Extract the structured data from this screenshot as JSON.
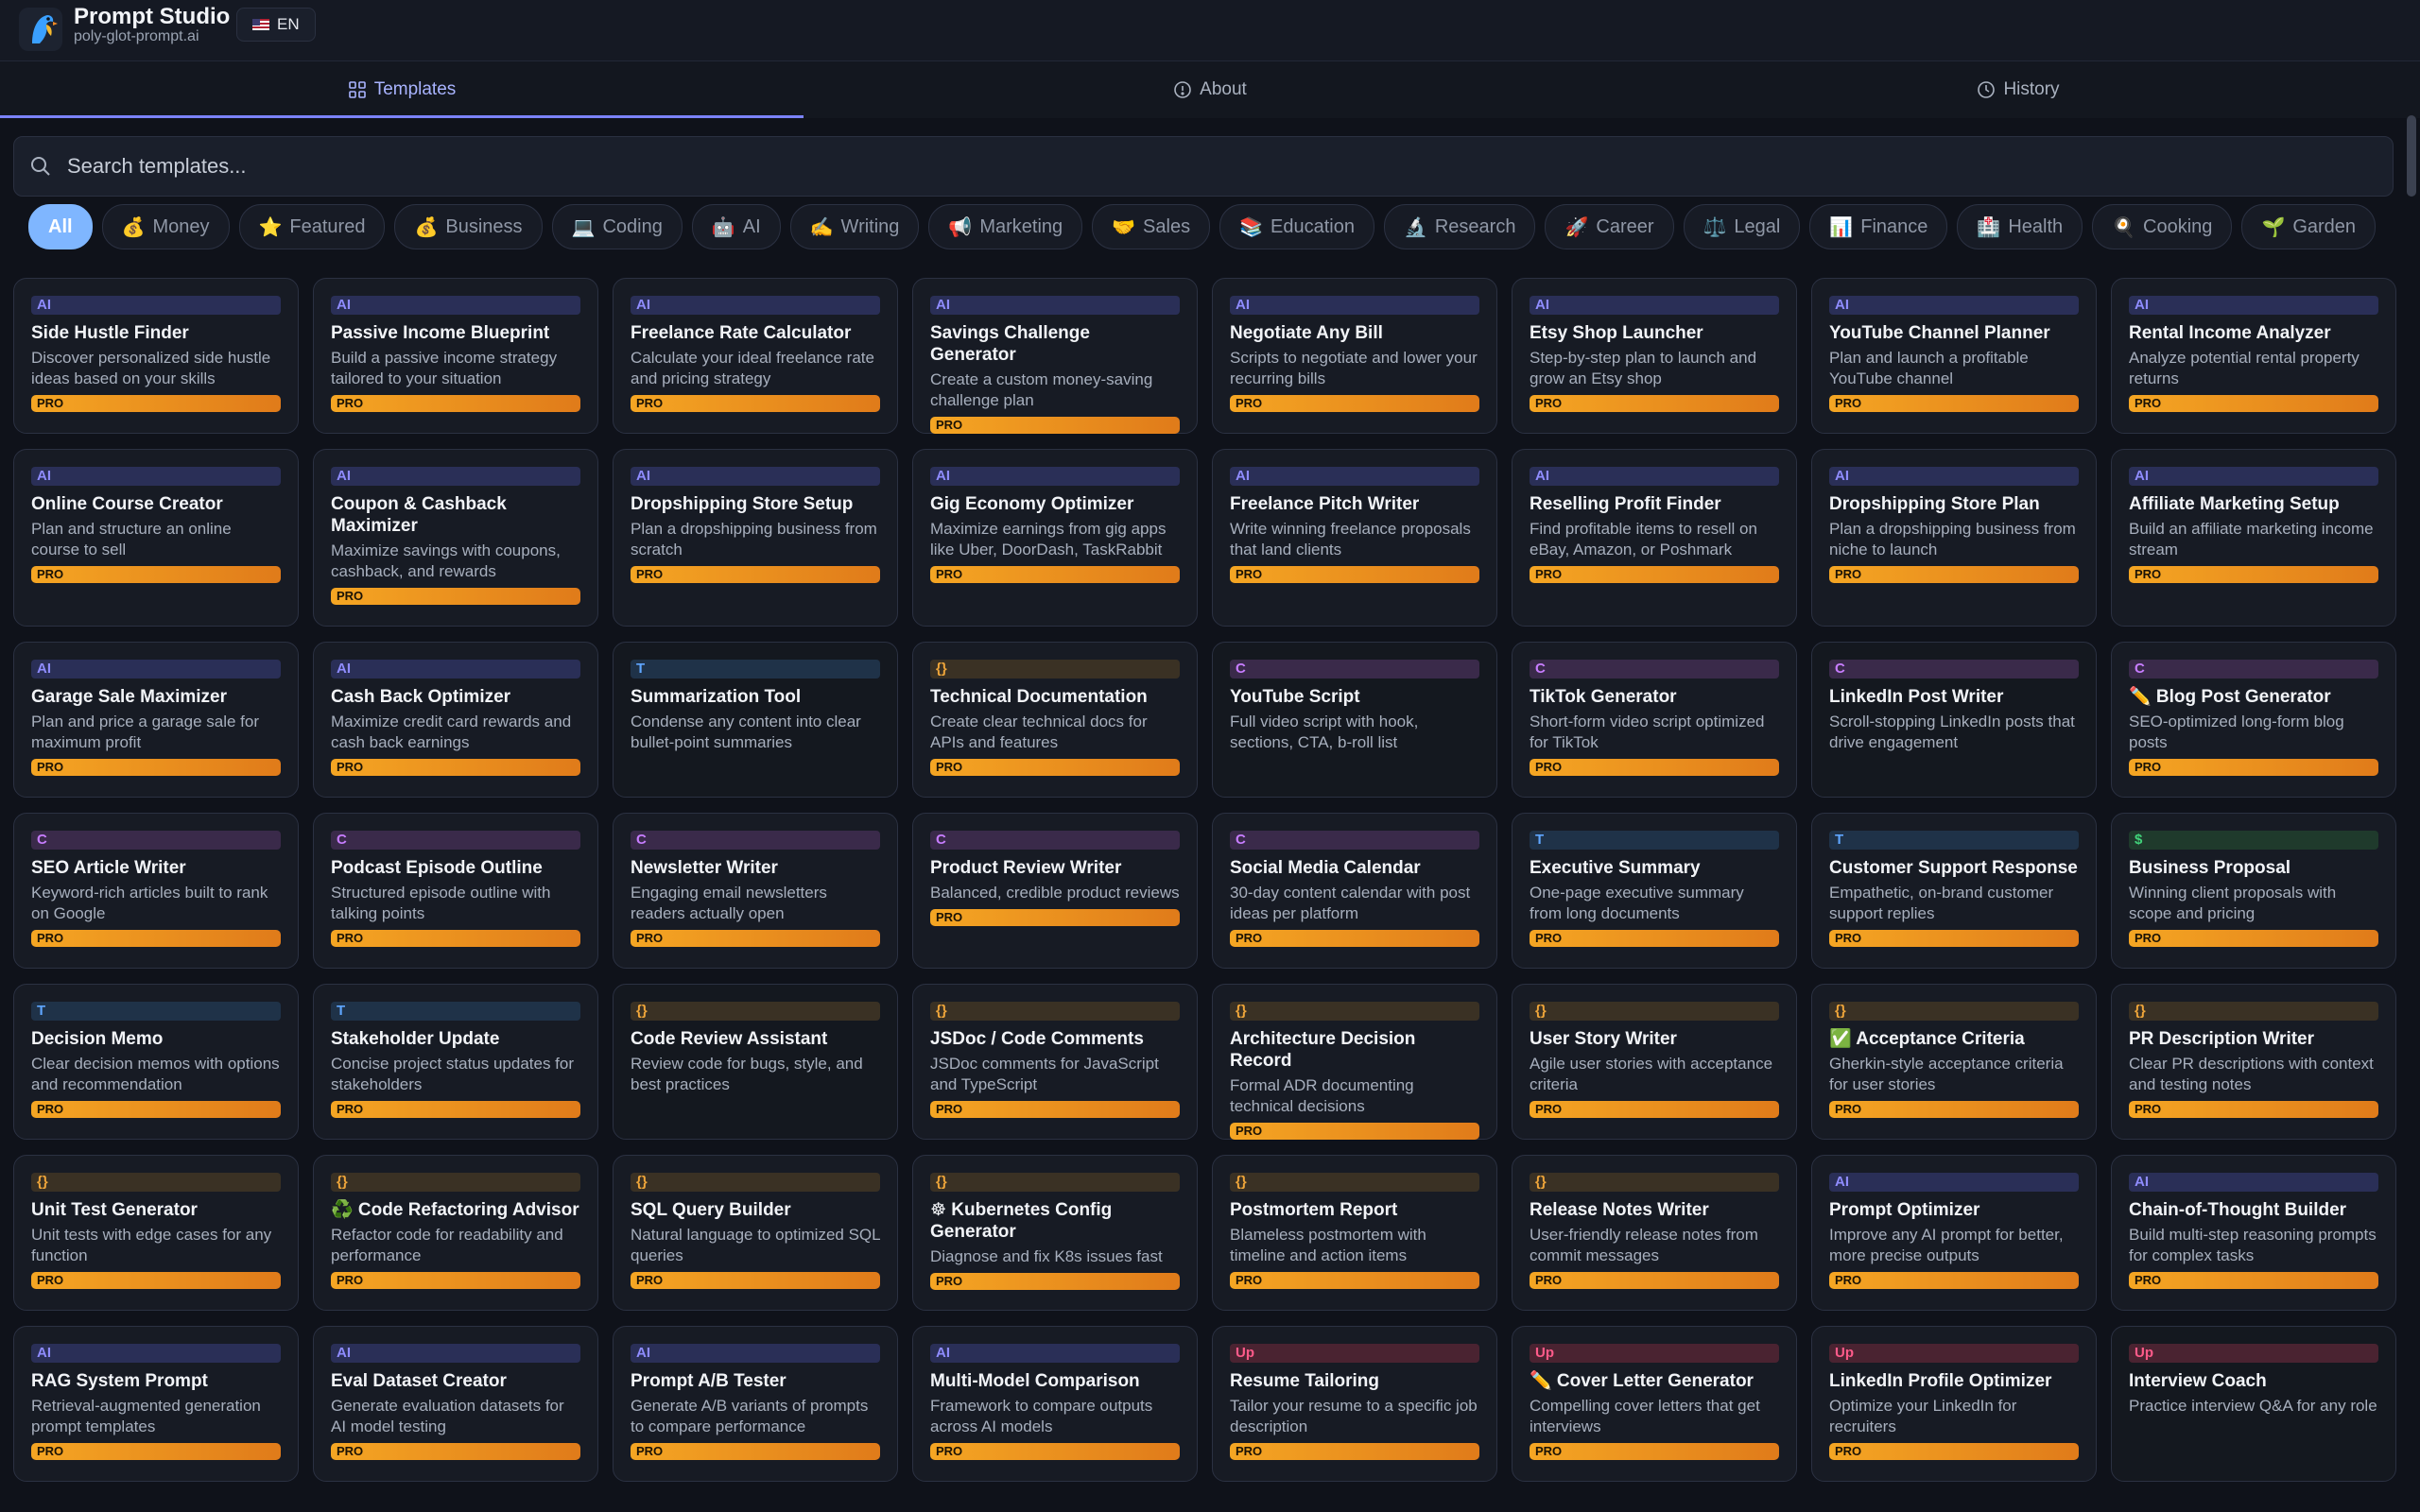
{
  "header": {
    "title": "Prompt Studio",
    "subtitle": "poly-glot-prompt.ai",
    "language": "EN"
  },
  "tabs": [
    {
      "label": "Templates",
      "icon": "grid-icon",
      "active": true
    },
    {
      "label": "About",
      "icon": "info-icon",
      "active": false
    },
    {
      "label": "History",
      "icon": "clock-icon",
      "active": false
    }
  ],
  "search": {
    "placeholder": "Search templates..."
  },
  "categories": [
    {
      "label": "All",
      "icon": "",
      "active": true
    },
    {
      "label": "Money",
      "icon": "💰"
    },
    {
      "label": "Featured",
      "icon": "⭐"
    },
    {
      "label": "Business",
      "icon": "💰"
    },
    {
      "label": "Coding",
      "icon": "💻"
    },
    {
      "label": "AI",
      "icon": "🤖"
    },
    {
      "label": "Writing",
      "icon": "✍️"
    },
    {
      "label": "Marketing",
      "icon": "📢"
    },
    {
      "label": "Sales",
      "icon": "🤝"
    },
    {
      "label": "Education",
      "icon": "📚"
    },
    {
      "label": "Research",
      "icon": "🔬"
    },
    {
      "label": "Career",
      "icon": "🚀"
    },
    {
      "label": "Legal",
      "icon": "⚖️"
    },
    {
      "label": "Finance",
      "icon": "📊"
    },
    {
      "label": "Health",
      "icon": "🏥"
    },
    {
      "label": "Cooking",
      "icon": "🍳"
    },
    {
      "label": "Garden",
      "icon": "🌱"
    }
  ],
  "pro_label": "PRO",
  "rows": [
    [
      {
        "tag": "AI",
        "kind": "ai",
        "title": "Side Hustle Finder",
        "desc": "Discover personalized side hustle ideas based on your skills",
        "pro": true
      },
      {
        "tag": "AI",
        "kind": "ai",
        "title": "Passive Income Blueprint",
        "desc": "Build a passive income strategy tailored to your situation",
        "pro": true
      },
      {
        "tag": "AI",
        "kind": "ai",
        "title": "Freelance Rate Calculator",
        "desc": "Calculate your ideal freelance rate and pricing strategy",
        "pro": true
      },
      {
        "tag": "AI",
        "kind": "ai",
        "title": "Savings Challenge Generator",
        "desc": "Create a custom money-saving challenge plan",
        "pro": true
      },
      {
        "tag": "AI",
        "kind": "ai",
        "title": "Negotiate Any Bill",
        "desc": "Scripts to negotiate and lower your recurring bills",
        "pro": true
      },
      {
        "tag": "AI",
        "kind": "ai",
        "title": "Etsy Shop Launcher",
        "desc": "Step-by-step plan to launch and grow an Etsy shop",
        "pro": true
      },
      {
        "tag": "AI",
        "kind": "ai",
        "title": "YouTube Channel Planner",
        "desc": "Plan and launch a profitable YouTube channel",
        "pro": true
      },
      {
        "tag": "AI",
        "kind": "ai",
        "title": "Rental Income Analyzer",
        "desc": "Analyze potential rental property returns",
        "pro": true
      }
    ],
    [
      {
        "tag": "AI",
        "kind": "ai",
        "title": "Online Course Creator",
        "desc": "Plan and structure an online course to sell",
        "pro": true
      },
      {
        "tag": "AI",
        "kind": "ai",
        "title": "Coupon & Cashback Maximizer",
        "desc": "Maximize savings with coupons, cashback, and rewards",
        "pro": true
      },
      {
        "tag": "AI",
        "kind": "ai",
        "title": "Dropshipping Store Setup",
        "desc": "Plan a dropshipping business from scratch",
        "pro": true
      },
      {
        "tag": "AI",
        "kind": "ai",
        "title": "Gig Economy Optimizer",
        "desc": "Maximize earnings from gig apps like Uber, DoorDash, TaskRabbit",
        "pro": true
      },
      {
        "tag": "AI",
        "kind": "ai",
        "title": "Freelance Pitch Writer",
        "desc": "Write winning freelance proposals that land clients",
        "pro": true
      },
      {
        "tag": "AI",
        "kind": "ai",
        "title": "Reselling Profit Finder",
        "desc": "Find profitable items to resell on eBay, Amazon, or Poshmark",
        "pro": true
      },
      {
        "tag": "AI",
        "kind": "ai",
        "title": "Dropshipping Store Plan",
        "desc": "Plan a dropshipping business from niche to launch",
        "pro": true
      },
      {
        "tag": "AI",
        "kind": "ai",
        "title": "Affiliate Marketing Setup",
        "desc": "Build an affiliate marketing income stream",
        "pro": true
      }
    ],
    [
      {
        "tag": "AI",
        "kind": "ai",
        "title": "Garage Sale Maximizer",
        "desc": "Plan and price a garage sale for maximum profit",
        "pro": true
      },
      {
        "tag": "AI",
        "kind": "ai",
        "title": "Cash Back Optimizer",
        "desc": "Maximize credit card rewards and cash back earnings",
        "pro": true
      },
      {
        "tag": "T",
        "kind": "t",
        "title": "Summarization Tool",
        "desc": "Condense any content into clear bullet-point summaries",
        "pro": false
      },
      {
        "tag": "{}",
        "kind": "code",
        "title": "Technical Documentation",
        "desc": "Create clear technical docs for APIs and features",
        "pro": true
      },
      {
        "tag": "C",
        "kind": "c",
        "title": "YouTube Script",
        "desc": "Full video script with hook, sections, CTA, b-roll list",
        "pro": false
      },
      {
        "tag": "C",
        "kind": "c",
        "title": "TikTok Generator",
        "desc": "Short-form video script optimized for TikTok",
        "pro": true
      },
      {
        "tag": "C",
        "kind": "c",
        "title": "LinkedIn Post Writer",
        "desc": "Scroll-stopping LinkedIn posts that drive engagement",
        "pro": false
      },
      {
        "tag": "C",
        "kind": "c",
        "title": "✏️ Blog Post Generator",
        "desc": "SEO-optimized long-form blog posts",
        "pro": true
      }
    ],
    [
      {
        "tag": "C",
        "kind": "c",
        "title": "SEO Article Writer",
        "desc": "Keyword-rich articles built to rank on Google",
        "pro": true
      },
      {
        "tag": "C",
        "kind": "c",
        "title": "Podcast Episode Outline",
        "desc": "Structured episode outline with talking points",
        "pro": true
      },
      {
        "tag": "C",
        "kind": "c",
        "title": "Newsletter Writer",
        "desc": "Engaging email newsletters readers actually open",
        "pro": true
      },
      {
        "tag": "C",
        "kind": "c",
        "title": "Product Review Writer",
        "desc": "Balanced, credible product reviews",
        "pro": true
      },
      {
        "tag": "C",
        "kind": "c",
        "title": "Social Media Calendar",
        "desc": "30-day content calendar with post ideas per platform",
        "pro": true
      },
      {
        "tag": "T",
        "kind": "t",
        "title": "Executive Summary",
        "desc": "One-page executive summary from long documents",
        "pro": true
      },
      {
        "tag": "T",
        "kind": "t",
        "title": "Customer Support Response",
        "desc": "Empathetic, on-brand customer support replies",
        "pro": true
      },
      {
        "tag": "$",
        "kind": "dollar",
        "title": "Business Proposal",
        "desc": "Winning client proposals with scope and pricing",
        "pro": true
      }
    ],
    [
      {
        "tag": "T",
        "kind": "t",
        "title": "Decision Memo",
        "desc": "Clear decision memos with options and recommendation",
        "pro": true
      },
      {
        "tag": "T",
        "kind": "t",
        "title": "Stakeholder Update",
        "desc": "Concise project status updates for stakeholders",
        "pro": true
      },
      {
        "tag": "{}",
        "kind": "code",
        "title": "Code Review Assistant",
        "desc": "Review code for bugs, style, and best practices",
        "pro": false
      },
      {
        "tag": "{}",
        "kind": "code",
        "title": "JSDoc / Code Comments",
        "desc": "JSDoc comments for JavaScript and TypeScript",
        "pro": true
      },
      {
        "tag": "{}",
        "kind": "code",
        "title": "Architecture Decision Record",
        "desc": "Formal ADR documenting technical decisions",
        "pro": true
      },
      {
        "tag": "{}",
        "kind": "code",
        "title": "User Story Writer",
        "desc": "Agile user stories with acceptance criteria",
        "pro": true
      },
      {
        "tag": "{}",
        "kind": "code",
        "title": "✅ Acceptance Criteria",
        "desc": "Gherkin-style acceptance criteria for user stories",
        "pro": true
      },
      {
        "tag": "{}",
        "kind": "code",
        "title": "PR Description Writer",
        "desc": "Clear PR descriptions with context and testing notes",
        "pro": true
      }
    ],
    [
      {
        "tag": "{}",
        "kind": "code",
        "title": "Unit Test Generator",
        "desc": "Unit tests with edge cases for any function",
        "pro": true
      },
      {
        "tag": "{}",
        "kind": "code",
        "title": "♻️ Code Refactoring Advisor",
        "desc": "Refactor code for readability and performance",
        "pro": true
      },
      {
        "tag": "{}",
        "kind": "code",
        "title": "SQL Query Builder",
        "desc": "Natural language to optimized SQL queries",
        "pro": true
      },
      {
        "tag": "{}",
        "kind": "code",
        "title": "☸ Kubernetes Config Generator",
        "desc": "Diagnose and fix K8s issues fast",
        "pro": true
      },
      {
        "tag": "{}",
        "kind": "code",
        "title": "Postmortem Report",
        "desc": "Blameless postmortem with timeline and action items",
        "pro": true
      },
      {
        "tag": "{}",
        "kind": "code",
        "title": "Release Notes Writer",
        "desc": "User-friendly release notes from commit messages",
        "pro": true
      },
      {
        "tag": "AI",
        "kind": "ai",
        "title": "Prompt Optimizer",
        "desc": "Improve any AI prompt for better, more precise outputs",
        "pro": true
      },
      {
        "tag": "AI",
        "kind": "ai",
        "title": "Chain-of-Thought Builder",
        "desc": "Build multi-step reasoning prompts for complex tasks",
        "pro": true
      }
    ],
    [
      {
        "tag": "AI",
        "kind": "ai",
        "title": "RAG System Prompt",
        "desc": "Retrieval-augmented generation prompt templates",
        "pro": true
      },
      {
        "tag": "AI",
        "kind": "ai",
        "title": "Eval Dataset Creator",
        "desc": "Generate evaluation datasets for AI model testing",
        "pro": true
      },
      {
        "tag": "AI",
        "kind": "ai",
        "title": "Prompt A/B Tester",
        "desc": "Generate A/B variants of prompts to compare performance",
        "pro": true
      },
      {
        "tag": "AI",
        "kind": "ai",
        "title": "Multi-Model Comparison",
        "desc": "Framework to compare outputs across AI models",
        "pro": true
      },
      {
        "tag": "Up",
        "kind": "up",
        "title": "Resume Tailoring",
        "desc": "Tailor your resume to a specific job description",
        "pro": true
      },
      {
        "tag": "Up",
        "kind": "up",
        "title": "✏️ Cover Letter Generator",
        "desc": "Compelling cover letters that get interviews",
        "pro": true
      },
      {
        "tag": "Up",
        "kind": "up",
        "title": "LinkedIn Profile Optimizer",
        "desc": "Optimize your LinkedIn for recruiters",
        "pro": true
      },
      {
        "tag": "Up",
        "kind": "up",
        "title": "Interview Coach",
        "desc": "Practice interview Q&A for any role",
        "pro": false
      }
    ]
  ]
}
